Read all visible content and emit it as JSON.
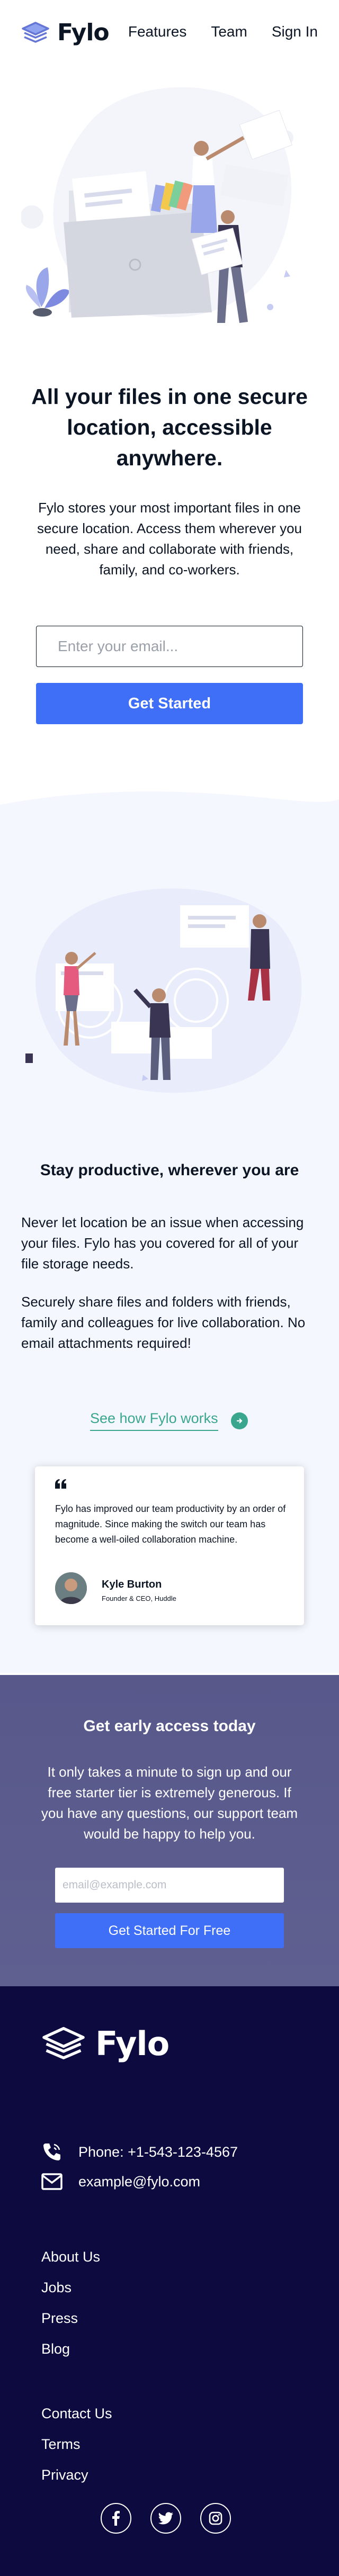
{
  "brand": {
    "name": "Fylo"
  },
  "nav": {
    "features": "Features",
    "team": "Team",
    "sign_in": "Sign In"
  },
  "hero": {
    "title": "All your files in one secure location, accessible anywhere.",
    "text": "Fylo stores your most important files in one secure location. Access them wherever you need, share and collaborate with friends, family, and co-workers.",
    "email_placeholder": "Enter your email...",
    "cta": "Get Started"
  },
  "productive": {
    "title": "Stay productive, wherever you are",
    "p1": "Never let location be an issue when accessing your files. Fylo has you covered for all of your file storage needs.",
    "p2": "Securely share files and folders with friends, family and colleagues for live collaboration. No email attachments required!",
    "link": "See how Fylo works"
  },
  "testimonial": {
    "quote": "Fylo has improved our team productivity by an order of magnitude. Since making the switch our team has become a well-oiled collaboration machine.",
    "name": "Kyle Burton",
    "role": "Founder & CEO, Huddle"
  },
  "early_access": {
    "title": "Get early access today",
    "text": "It only takes a minute to sign up and our free starter tier is extremely generous. If you have any questions, our support team would be happy to help you.",
    "email_placeholder": "email@example.com",
    "cta": "Get Started For Free"
  },
  "footer": {
    "phone": "Phone: +1-543-123-4567",
    "email": "example@fylo.com",
    "links_1": [
      "About Us",
      "Jobs",
      "Press",
      "Blog"
    ],
    "links_2": [
      "Contact Us",
      "Terms",
      "Privacy"
    ],
    "social_icons": [
      "facebook-icon",
      "twitter-icon",
      "instagram-icon"
    ]
  },
  "colors": {
    "accent_blue": "#3f6ff6",
    "link_teal": "#3ba68e",
    "dark_navy": "#0c0a3e",
    "early_access_bg": "#5a5b8c",
    "section_tint": "#f5f7ff"
  }
}
